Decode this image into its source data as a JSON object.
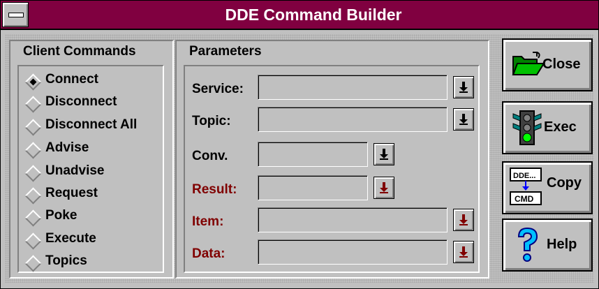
{
  "window": {
    "title": "DDE Command Builder"
  },
  "client_commands": {
    "title": "Client Commands",
    "items": [
      {
        "label": "Connect",
        "selected": true
      },
      {
        "label": "Disconnect",
        "selected": false
      },
      {
        "label": "Disconnect All",
        "selected": false
      },
      {
        "label": "Advise",
        "selected": false
      },
      {
        "label": "Unadvise",
        "selected": false
      },
      {
        "label": "Request",
        "selected": false
      },
      {
        "label": "Poke",
        "selected": false
      },
      {
        "label": "Execute",
        "selected": false
      },
      {
        "label": "Topics",
        "selected": false
      }
    ]
  },
  "parameters": {
    "title": "Parameters",
    "service": {
      "label": "Service:",
      "value": ""
    },
    "topic": {
      "label": "Topic:",
      "value": ""
    },
    "conv": {
      "label": "Conv.",
      "value": ""
    },
    "result": {
      "label": "Result:",
      "value": ""
    },
    "item": {
      "label": "Item:",
      "value": ""
    },
    "data": {
      "label": "Data:",
      "value": ""
    }
  },
  "buttons": {
    "close": "Close",
    "exec": "Exec",
    "copy": "Copy",
    "help": "Help",
    "copy_icon_top": "DDE...",
    "copy_icon_bottom": "CMD"
  },
  "colors": {
    "titlebar": "#800040",
    "disabled_label": "#800000",
    "face": "#c0c0c0"
  }
}
